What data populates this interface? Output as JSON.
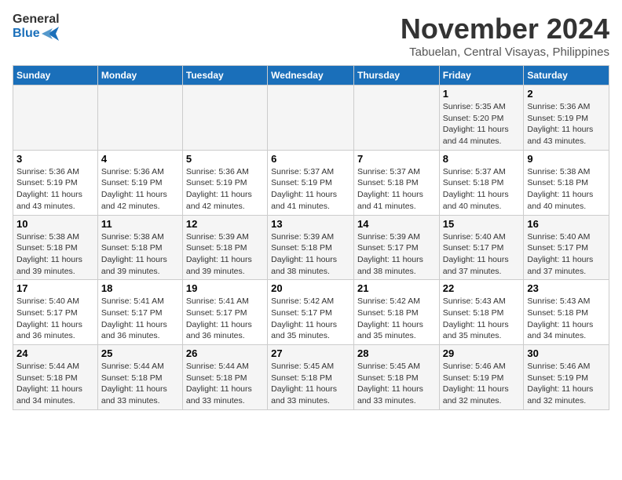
{
  "logo": {
    "line1": "General",
    "line2": "Blue"
  },
  "title": "November 2024",
  "subtitle": "Tabuelan, Central Visayas, Philippines",
  "days_of_week": [
    "Sunday",
    "Monday",
    "Tuesday",
    "Wednesday",
    "Thursday",
    "Friday",
    "Saturday"
  ],
  "weeks": [
    [
      {
        "day": "",
        "sunrise": "",
        "sunset": "",
        "daylight": ""
      },
      {
        "day": "",
        "sunrise": "",
        "sunset": "",
        "daylight": ""
      },
      {
        "day": "",
        "sunrise": "",
        "sunset": "",
        "daylight": ""
      },
      {
        "day": "",
        "sunrise": "",
        "sunset": "",
        "daylight": ""
      },
      {
        "day": "",
        "sunrise": "",
        "sunset": "",
        "daylight": ""
      },
      {
        "day": "1",
        "sunrise": "Sunrise: 5:35 AM",
        "sunset": "Sunset: 5:20 PM",
        "daylight": "Daylight: 11 hours and 44 minutes."
      },
      {
        "day": "2",
        "sunrise": "Sunrise: 5:36 AM",
        "sunset": "Sunset: 5:19 PM",
        "daylight": "Daylight: 11 hours and 43 minutes."
      }
    ],
    [
      {
        "day": "3",
        "sunrise": "Sunrise: 5:36 AM",
        "sunset": "Sunset: 5:19 PM",
        "daylight": "Daylight: 11 hours and 43 minutes."
      },
      {
        "day": "4",
        "sunrise": "Sunrise: 5:36 AM",
        "sunset": "Sunset: 5:19 PM",
        "daylight": "Daylight: 11 hours and 42 minutes."
      },
      {
        "day": "5",
        "sunrise": "Sunrise: 5:36 AM",
        "sunset": "Sunset: 5:19 PM",
        "daylight": "Daylight: 11 hours and 42 minutes."
      },
      {
        "day": "6",
        "sunrise": "Sunrise: 5:37 AM",
        "sunset": "Sunset: 5:19 PM",
        "daylight": "Daylight: 11 hours and 41 minutes."
      },
      {
        "day": "7",
        "sunrise": "Sunrise: 5:37 AM",
        "sunset": "Sunset: 5:18 PM",
        "daylight": "Daylight: 11 hours and 41 minutes."
      },
      {
        "day": "8",
        "sunrise": "Sunrise: 5:37 AM",
        "sunset": "Sunset: 5:18 PM",
        "daylight": "Daylight: 11 hours and 40 minutes."
      },
      {
        "day": "9",
        "sunrise": "Sunrise: 5:38 AM",
        "sunset": "Sunset: 5:18 PM",
        "daylight": "Daylight: 11 hours and 40 minutes."
      }
    ],
    [
      {
        "day": "10",
        "sunrise": "Sunrise: 5:38 AM",
        "sunset": "Sunset: 5:18 PM",
        "daylight": "Daylight: 11 hours and 39 minutes."
      },
      {
        "day": "11",
        "sunrise": "Sunrise: 5:38 AM",
        "sunset": "Sunset: 5:18 PM",
        "daylight": "Daylight: 11 hours and 39 minutes."
      },
      {
        "day": "12",
        "sunrise": "Sunrise: 5:39 AM",
        "sunset": "Sunset: 5:18 PM",
        "daylight": "Daylight: 11 hours and 39 minutes."
      },
      {
        "day": "13",
        "sunrise": "Sunrise: 5:39 AM",
        "sunset": "Sunset: 5:18 PM",
        "daylight": "Daylight: 11 hours and 38 minutes."
      },
      {
        "day": "14",
        "sunrise": "Sunrise: 5:39 AM",
        "sunset": "Sunset: 5:17 PM",
        "daylight": "Daylight: 11 hours and 38 minutes."
      },
      {
        "day": "15",
        "sunrise": "Sunrise: 5:40 AM",
        "sunset": "Sunset: 5:17 PM",
        "daylight": "Daylight: 11 hours and 37 minutes."
      },
      {
        "day": "16",
        "sunrise": "Sunrise: 5:40 AM",
        "sunset": "Sunset: 5:17 PM",
        "daylight": "Daylight: 11 hours and 37 minutes."
      }
    ],
    [
      {
        "day": "17",
        "sunrise": "Sunrise: 5:40 AM",
        "sunset": "Sunset: 5:17 PM",
        "daylight": "Daylight: 11 hours and 36 minutes."
      },
      {
        "day": "18",
        "sunrise": "Sunrise: 5:41 AM",
        "sunset": "Sunset: 5:17 PM",
        "daylight": "Daylight: 11 hours and 36 minutes."
      },
      {
        "day": "19",
        "sunrise": "Sunrise: 5:41 AM",
        "sunset": "Sunset: 5:17 PM",
        "daylight": "Daylight: 11 hours and 36 minutes."
      },
      {
        "day": "20",
        "sunrise": "Sunrise: 5:42 AM",
        "sunset": "Sunset: 5:17 PM",
        "daylight": "Daylight: 11 hours and 35 minutes."
      },
      {
        "day": "21",
        "sunrise": "Sunrise: 5:42 AM",
        "sunset": "Sunset: 5:18 PM",
        "daylight": "Daylight: 11 hours and 35 minutes."
      },
      {
        "day": "22",
        "sunrise": "Sunrise: 5:43 AM",
        "sunset": "Sunset: 5:18 PM",
        "daylight": "Daylight: 11 hours and 35 minutes."
      },
      {
        "day": "23",
        "sunrise": "Sunrise: 5:43 AM",
        "sunset": "Sunset: 5:18 PM",
        "daylight": "Daylight: 11 hours and 34 minutes."
      }
    ],
    [
      {
        "day": "24",
        "sunrise": "Sunrise: 5:44 AM",
        "sunset": "Sunset: 5:18 PM",
        "daylight": "Daylight: 11 hours and 34 minutes."
      },
      {
        "day": "25",
        "sunrise": "Sunrise: 5:44 AM",
        "sunset": "Sunset: 5:18 PM",
        "daylight": "Daylight: 11 hours and 33 minutes."
      },
      {
        "day": "26",
        "sunrise": "Sunrise: 5:44 AM",
        "sunset": "Sunset: 5:18 PM",
        "daylight": "Daylight: 11 hours and 33 minutes."
      },
      {
        "day": "27",
        "sunrise": "Sunrise: 5:45 AM",
        "sunset": "Sunset: 5:18 PM",
        "daylight": "Daylight: 11 hours and 33 minutes."
      },
      {
        "day": "28",
        "sunrise": "Sunrise: 5:45 AM",
        "sunset": "Sunset: 5:18 PM",
        "daylight": "Daylight: 11 hours and 33 minutes."
      },
      {
        "day": "29",
        "sunrise": "Sunrise: 5:46 AM",
        "sunset": "Sunset: 5:19 PM",
        "daylight": "Daylight: 11 hours and 32 minutes."
      },
      {
        "day": "30",
        "sunrise": "Sunrise: 5:46 AM",
        "sunset": "Sunset: 5:19 PM",
        "daylight": "Daylight: 11 hours and 32 minutes."
      }
    ]
  ]
}
